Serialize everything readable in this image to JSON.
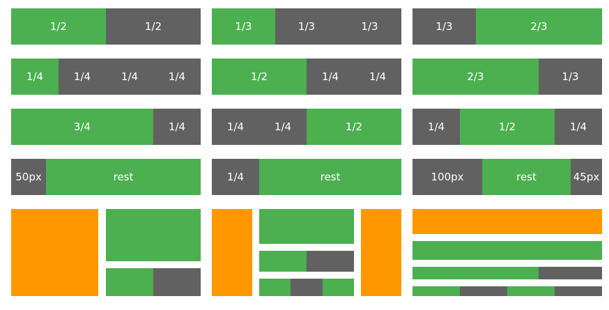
{
  "palette": {
    "green": "#4caf50",
    "gray": "#616161",
    "orange": "#ff9800"
  },
  "rows": [
    [
      {
        "cells": [
          {
            "label": "1/2"
          },
          {
            "label": "1/2"
          }
        ]
      },
      {
        "cells": [
          {
            "label": "1/3"
          },
          {
            "label": "1/3"
          },
          {
            "label": "1/3"
          }
        ]
      },
      {
        "cells": [
          {
            "label": "1/3"
          },
          {
            "label": "2/3"
          }
        ]
      }
    ],
    [
      {
        "cells": [
          {
            "label": "1/4"
          },
          {
            "label": "1/4"
          },
          {
            "label": "1/4"
          },
          {
            "label": "1/4"
          }
        ]
      },
      {
        "cells": [
          {
            "label": "1/2"
          },
          {
            "label": "1/4"
          },
          {
            "label": "1/4"
          }
        ]
      },
      {
        "cells": [
          {
            "label": "2/3"
          },
          {
            "label": "1/3"
          }
        ]
      }
    ],
    [
      {
        "cells": [
          {
            "label": "3/4"
          },
          {
            "label": "1/4"
          }
        ]
      },
      {
        "cells": [
          {
            "label": "1/4"
          },
          {
            "label": "1/4"
          },
          {
            "label": "1/2"
          }
        ]
      },
      {
        "cells": [
          {
            "label": "1/4"
          },
          {
            "label": "1/2"
          },
          {
            "label": "1/4"
          }
        ]
      }
    ],
    [
      {
        "cells": [
          {
            "label": "50px"
          },
          {
            "label": "rest"
          }
        ]
      },
      {
        "cells": [
          {
            "label": "1/4"
          },
          {
            "label": "rest"
          }
        ]
      },
      {
        "cells": [
          {
            "label": "100px"
          },
          {
            "label": "rest"
          },
          {
            "label": "45px"
          }
        ]
      }
    ]
  ]
}
